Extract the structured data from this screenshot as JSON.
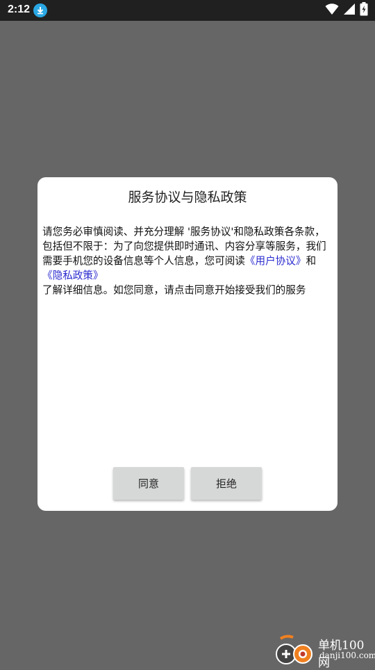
{
  "status_bar": {
    "time": "2:12",
    "icons": [
      "download-icon",
      "wifi-icon",
      "signal-icon",
      "battery-charging-icon"
    ],
    "download_color": "#2aa7e4"
  },
  "dialog": {
    "title": "服务协议与隐私政策",
    "body_text_1": "请您务必审慎阅读、并充分理解 '服务协议'和隐私政策各条款，包括但不限于：为了向您提供即时通讯、内容分享等服务，我们需要手机您的设备信息等个人信息，您可阅读",
    "link_user_agreement": "《用户协议》",
    "and_text": "和",
    "link_privacy_policy": "《隐私政策》",
    "body_text_2": "了解详细信息。如您同意，请点击同意开始接受我们的服务",
    "agree_label": "同意",
    "refuse_label": "拒绝",
    "link_color": "#2b2bd0"
  },
  "watermark": {
    "line1": "单机100网",
    "line2": "danji100.com"
  }
}
